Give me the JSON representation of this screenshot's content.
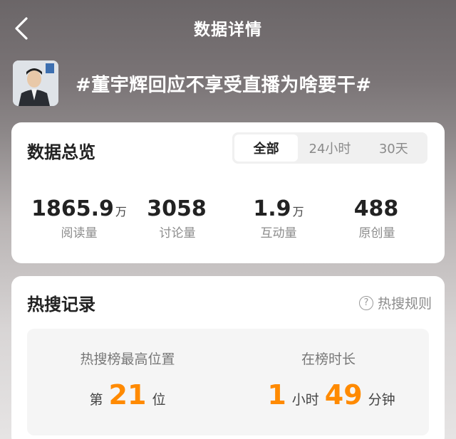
{
  "header": {
    "title": "数据详情"
  },
  "topic": {
    "title": "#董宇辉回应不享受直播为啥要干#"
  },
  "overview": {
    "heading": "数据总览",
    "tabs": [
      {
        "label": "全部",
        "active": true
      },
      {
        "label": "24小时",
        "active": false
      },
      {
        "label": "30天",
        "active": false
      }
    ],
    "stats": [
      {
        "value": "1865.9",
        "unit": "万",
        "label": "阅读量"
      },
      {
        "value": "3058",
        "unit": "",
        "label": "讨论量"
      },
      {
        "value": "1.9",
        "unit": "万",
        "label": "互动量"
      },
      {
        "value": "488",
        "unit": "",
        "label": "原创量"
      }
    ]
  },
  "hot": {
    "heading": "热搜记录",
    "rules_label": "热搜规则",
    "rank_label": "热搜榜最高位置",
    "rank_prefix": "第",
    "rank_value": "21",
    "rank_suffix": "位",
    "duration_label": "在榜时长",
    "hours_value": "1",
    "hours_unit": "小时",
    "minutes_value": "49",
    "minutes_unit": "分钟"
  },
  "colors": {
    "accent": "#ff8a00"
  }
}
